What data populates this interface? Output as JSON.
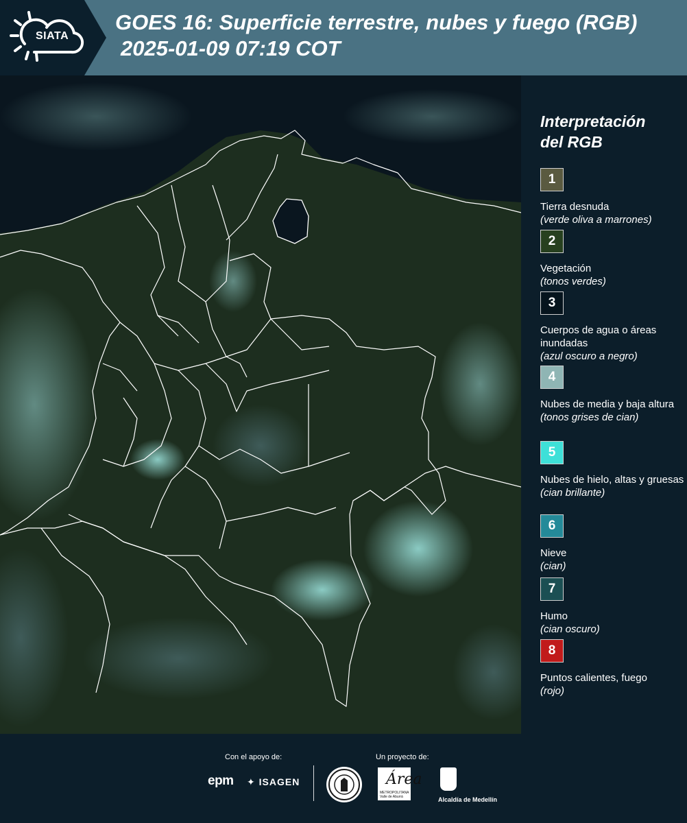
{
  "header": {
    "logo_text": "SIATA",
    "title_line1": "GOES 16: Superficie terrestre, nubes y fuego (RGB)",
    "title_line2": "2025-01-09 07:19 COT"
  },
  "legend": {
    "title_line1": "Interpretación",
    "title_line2": "del RGB",
    "items": [
      {
        "num": "1",
        "color": "#5a5a40",
        "name": "Tierra desnuda",
        "desc": "(verde oliva a marrones)"
      },
      {
        "num": "2",
        "color": "#27401f",
        "name": "Vegetación",
        "desc": "(tonos verdes)"
      },
      {
        "num": "3",
        "color": "#06141d",
        "name": "Cuerpos de agua o áreas inundadas",
        "desc": "(azul oscuro a negro)"
      },
      {
        "num": "4",
        "color": "#8fb5b4",
        "name": "Nubes de media y baja altura",
        "desc": "(tonos grises de cian)"
      },
      {
        "num": "5",
        "color": "#3ee0d8",
        "name": "Nubes de hielo, altas y gruesas",
        "desc": "(cian brillante)"
      },
      {
        "num": "6",
        "color": "#248a99",
        "name": "Nieve",
        "desc": "(cian)"
      },
      {
        "num": "7",
        "color": "#1b4f53",
        "name": "Humo",
        "desc": "(cian oscuro)"
      },
      {
        "num": "8",
        "color": "#c11b1b",
        "name": "Puntos calientes, fuego",
        "desc": "(rojo)"
      }
    ]
  },
  "footer": {
    "support_label": "Con el apoyo de:",
    "project_label": "Un proyecto de:",
    "epm": "epm",
    "isagen": "ISAGEN",
    "area_logo": "Área",
    "area_subtitle": "METROPOLITANA Valle de Aburrá",
    "alcaldia": "Alcaldía de Medellín"
  },
  "colors": {
    "header_bg": "#4a7283",
    "panel_bg": "#0c1e2a",
    "sea": "#0a161f",
    "land": "#1c2c1e"
  }
}
